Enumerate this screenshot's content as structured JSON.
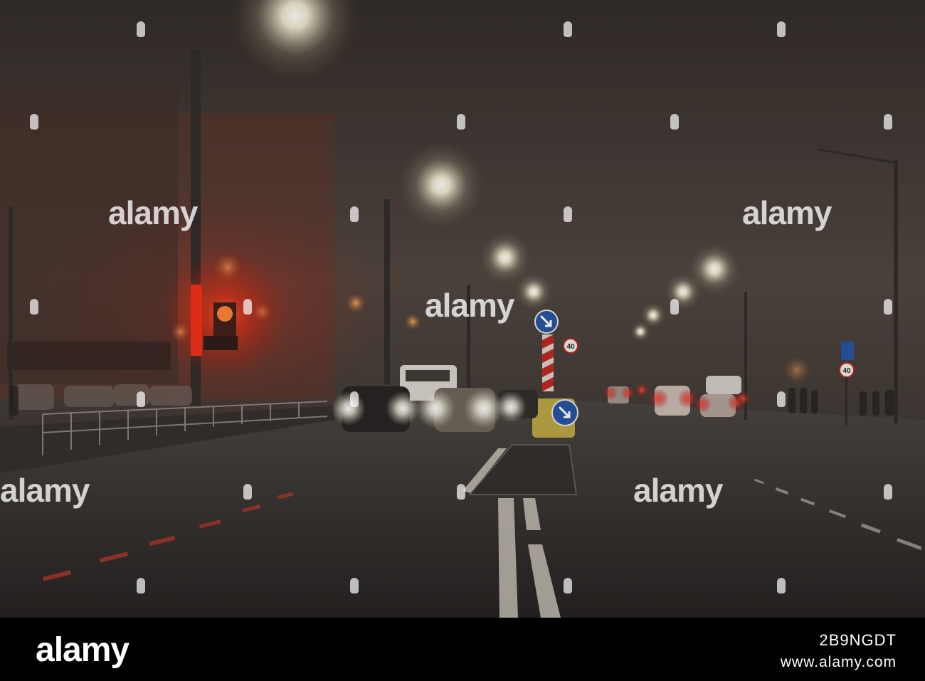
{
  "photo": {
    "description_icons": [
      "street-lamp-icon",
      "traffic-light-icon",
      "car-icon",
      "road-sign-icon"
    ],
    "speed_limit_sign_text": "40",
    "speed_limit_sign_text_right": "40",
    "colors": {
      "fog": "#3c3530",
      "road": "#2a2826",
      "red_glow": "#ff2a10",
      "lamp_glow": "#fffbe6"
    }
  },
  "watermark": {
    "text": "alamy"
  },
  "footer": {
    "logo": "alamy",
    "image_id": "2B9NGDT",
    "url": "www.alamy.com"
  }
}
